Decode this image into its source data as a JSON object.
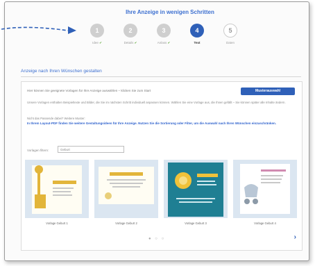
{
  "wizard": {
    "title": "Ihre Anzeige in wenigen Schritten",
    "steps": [
      {
        "number": "1",
        "label": "Idee",
        "status": "done",
        "check": "✔"
      },
      {
        "number": "2",
        "label": "Details",
        "status": "done",
        "check": "✔"
      },
      {
        "number": "3",
        "label": "Anlass",
        "status": "done",
        "check": "✔"
      },
      {
        "number": "4",
        "label": "Text",
        "status": "active",
        "check": ""
      },
      {
        "number": "5",
        "label": "Daten",
        "status": "pending",
        "check": ""
      }
    ]
  },
  "section": {
    "title": "Anzeige nach Ihren Wünschen gestalten"
  },
  "panel": {
    "intro": "Hier können Sie geeignete Vorlagen für Ihre Anzeige auswählen – klicken Sie zum Start",
    "sort_button": "Musterauswahl",
    "description": "Unsere Vorlagen enthalten Beispieltexte und Bilder, die Sie im nächsten Schritt individuell anpassen können. Wählen Sie eine Vorlage aus, die Ihnen gefällt – Sie können später alle Inhalte ändern.",
    "question": "Nicht das Passende dabei? Weitere Muster:",
    "link_text": "In Ihrem Layout-PDF finden Sie weitere Gestaltungsideen für Ihre Anzeige. Nutzen Sie die Sortierung oder Filter, um die Auswahl nach Ihren Wünschen einzuschränken.",
    "filter_label": "Vorlagen filtern:",
    "filter_value": "Geburt",
    "cards": [
      {
        "label": "Vorlage Geburt 1"
      },
      {
        "label": "Vorlage Geburt 2"
      },
      {
        "label": "Vorlage Geburt 3"
      },
      {
        "label": "Vorlage Geburt 4"
      }
    ],
    "pagination": "● ○ ○",
    "next_icon": "›"
  },
  "colors": {
    "primary": "#2f60b8",
    "done": "#cfcfcf",
    "accent_card": "#1f7f93"
  }
}
